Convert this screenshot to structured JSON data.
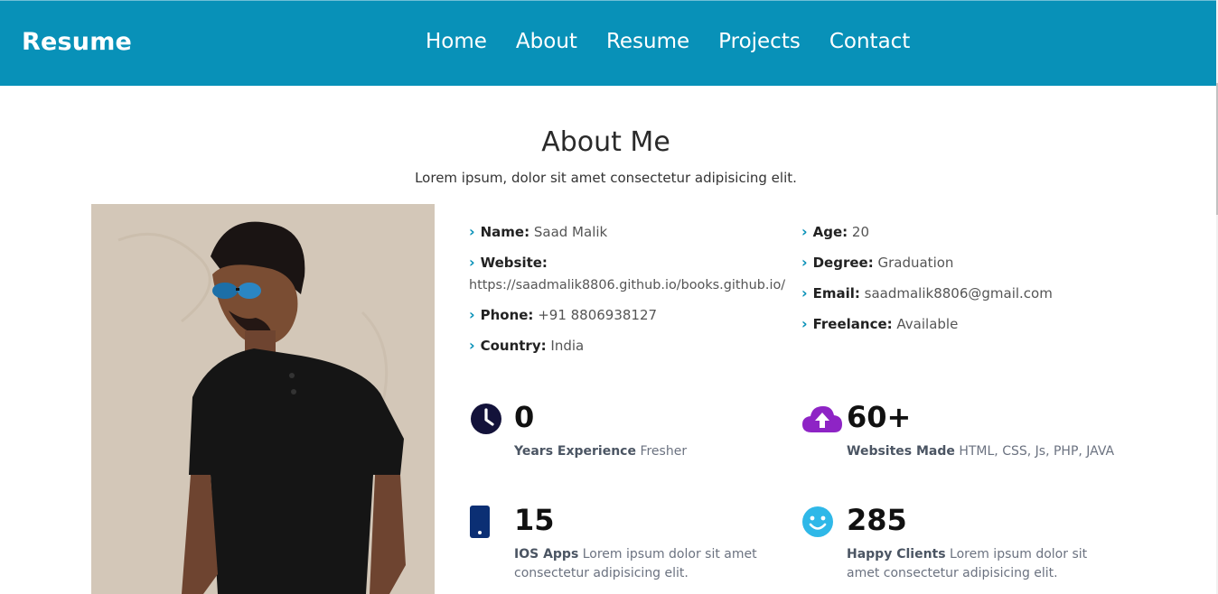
{
  "header": {
    "brand": "Resume",
    "nav": [
      "Home",
      "About",
      "Resume",
      "Projects",
      "Contact"
    ]
  },
  "section": {
    "title": "About Me",
    "subtitle": "Lorem ipsum, dolor sit amet consectetur adipisicing elit."
  },
  "details_left": [
    {
      "key": "Name:",
      "value": "Saad Malik"
    },
    {
      "key": "Website:",
      "value": "https://saadmalik8806.github.io/books.github.io/"
    },
    {
      "key": "Phone:",
      "value": "+91 8806938127"
    },
    {
      "key": "Country:",
      "value": "India"
    }
  ],
  "details_right": [
    {
      "key": "Age:",
      "value": "20"
    },
    {
      "key": "Degree:",
      "value": "Graduation"
    },
    {
      "key": "Email:",
      "value": "saadmalik8806@gmail.com"
    },
    {
      "key": "Freelance:",
      "value": "Available"
    }
  ],
  "stats": [
    {
      "icon": "clock-icon",
      "number": "0",
      "label": "Years Experience",
      "text": "Fresher"
    },
    {
      "icon": "cloud-upload-icon",
      "number": "60+",
      "label": "Websites Made",
      "text": "HTML, CSS, Js, PHP, JAVA"
    },
    {
      "icon": "phone-icon",
      "number": "15",
      "label": "IOS Apps",
      "text": "Lorem ipsum dolor sit amet consectetur adipisicing elit."
    },
    {
      "icon": "smile-icon",
      "number": "285",
      "label": "Happy Clients",
      "text": "Lorem ipsum dolor sit amet consectetur adipisicing elit."
    }
  ],
  "colors": {
    "header": "#0891b8",
    "accent": "#0891b8",
    "clock_icon": "#13123a",
    "cloud_icon": "#8e24c5",
    "phone_icon": "#0b2f74",
    "smile_icon": "#2fb8e8"
  }
}
